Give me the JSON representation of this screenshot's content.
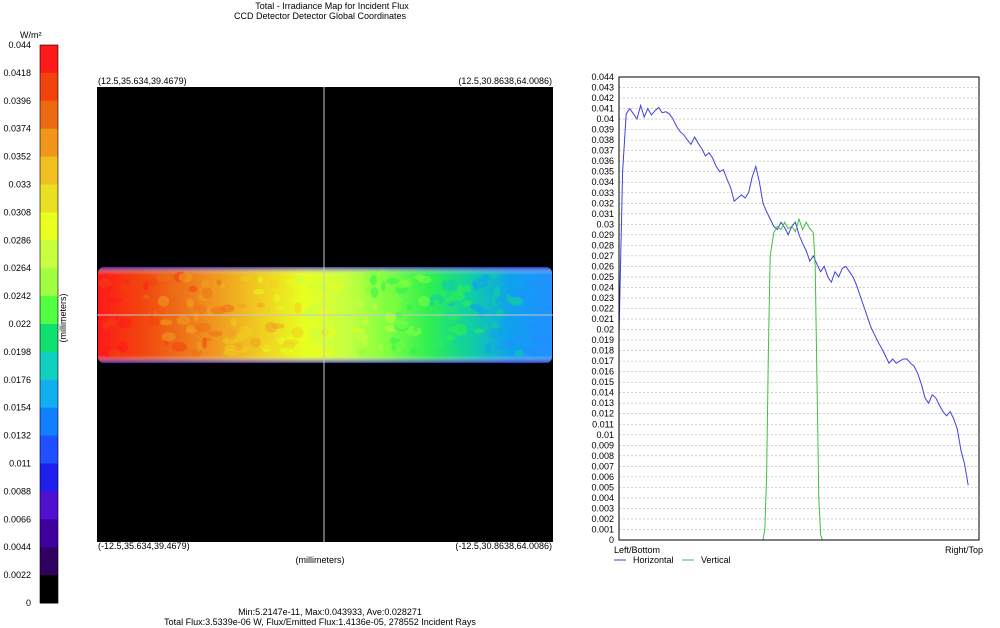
{
  "title_line1": "Total - Irradiance Map for Incident Flux",
  "title_line2": "CCD Detector Detector    Global Coordinates",
  "colorbar": {
    "unit": "W/m²",
    "ticks": [
      "0.044",
      "0.0418",
      "0.0396",
      "0.0374",
      "0.0352",
      "0.033",
      "0.0308",
      "0.0286",
      "0.0264",
      "0.0242",
      "0.022",
      "0.0198",
      "0.0176",
      "0.0154",
      "0.0132",
      "0.011",
      "0.0088",
      "0.0066",
      "0.0044",
      "0.0022",
      "0"
    ],
    "colors": [
      "#ff1a1a",
      "#f2420e",
      "#ee6a10",
      "#f0961a",
      "#f0c020",
      "#e8e020",
      "#e8ff20",
      "#c8ff40",
      "#a0ff40",
      "#50ff40",
      "#10e070",
      "#10d0c0",
      "#10b0f0",
      "#1080ff",
      "#2050ff",
      "#2020ee",
      "#5010d0",
      "#4000a0",
      "#300060",
      "#000000"
    ]
  },
  "map": {
    "ylabel": "(millimeters)",
    "xlabel": "(millimeters)",
    "corner_tl": "(12.5,35.634,39.4679)",
    "corner_tr": "(12.5,30.8638,64.0086)",
    "corner_bl": "(-12.5,35.634,39.4679)",
    "corner_br": "(-12.5,30.8638,64.0086)",
    "background": "#000000",
    "gradient": [
      "#ff1a1a",
      "#f2420e",
      "#ee7018",
      "#f0a020",
      "#f0d020",
      "#e8ff20",
      "#c8ff40",
      "#80ff40",
      "#30f050",
      "#10d0a0",
      "#10a0f0",
      "#2090ff"
    ]
  },
  "stats_line1": "Min:5.2147e-11, Max:0.043933, Ave:0.028271",
  "stats_line2": "Total Flux:3.5339e-06 W, Flux/Emitted Flux:1.4136e-05, 278552 Incident Rays",
  "chart_data": {
    "type": "line",
    "ylim": [
      0,
      0.044
    ],
    "y_ticks": [
      "0.044",
      "0.043",
      "0.042",
      "0.041",
      "0.04",
      "0.039",
      "0.038",
      "0.037",
      "0.036",
      "0.035",
      "0.034",
      "0.033",
      "0.032",
      "0.031",
      "0.03",
      "0.029",
      "0.028",
      "0.027",
      "0.026",
      "0.025",
      "0.024",
      "0.023",
      "0.022",
      "0.021",
      "0.02",
      "0.019",
      "0.018",
      "0.017",
      "0.016",
      "0.015",
      "0.014",
      "0.013",
      "0.012",
      "0.011",
      "0.01",
      "0.009",
      "0.008",
      "0.007",
      "0.006",
      "0.005",
      "0.004",
      "0.003",
      "0.002",
      "0.001",
      "0"
    ],
    "xlim": [
      0,
      1
    ],
    "x_left_label": "Left/Bottom",
    "x_right_label": "Right/Top",
    "grid": true,
    "legend_position": "bottom-left",
    "series": [
      {
        "name": "Horizontal",
        "color": "#4040e0",
        "points": [
          [
            0.0,
            0.0195
          ],
          [
            0.01,
            0.035
          ],
          [
            0.02,
            0.0405
          ],
          [
            0.03,
            0.041
          ],
          [
            0.04,
            0.0405
          ],
          [
            0.05,
            0.04
          ],
          [
            0.06,
            0.0413
          ],
          [
            0.07,
            0.0402
          ],
          [
            0.08,
            0.041
          ],
          [
            0.09,
            0.0404
          ],
          [
            0.1,
            0.0408
          ],
          [
            0.11,
            0.0411
          ],
          [
            0.12,
            0.0406
          ],
          [
            0.13,
            0.0407
          ],
          [
            0.14,
            0.0405
          ],
          [
            0.15,
            0.04
          ],
          [
            0.16,
            0.0393
          ],
          [
            0.17,
            0.0388
          ],
          [
            0.18,
            0.0385
          ],
          [
            0.19,
            0.038
          ],
          [
            0.2,
            0.0376
          ],
          [
            0.21,
            0.0383
          ],
          [
            0.22,
            0.0377
          ],
          [
            0.23,
            0.0372
          ],
          [
            0.24,
            0.0365
          ],
          [
            0.25,
            0.0368
          ],
          [
            0.26,
            0.0363
          ],
          [
            0.27,
            0.0355
          ],
          [
            0.28,
            0.035
          ],
          [
            0.29,
            0.0352
          ],
          [
            0.3,
            0.0343
          ],
          [
            0.31,
            0.0335
          ],
          [
            0.32,
            0.0322
          ],
          [
            0.33,
            0.0325
          ],
          [
            0.34,
            0.0328
          ],
          [
            0.35,
            0.0325
          ],
          [
            0.36,
            0.033
          ],
          [
            0.37,
            0.0345
          ],
          [
            0.38,
            0.0355
          ],
          [
            0.39,
            0.034
          ],
          [
            0.4,
            0.032
          ],
          [
            0.41,
            0.0312
          ],
          [
            0.42,
            0.0305
          ],
          [
            0.43,
            0.0298
          ],
          [
            0.44,
            0.0295
          ],
          [
            0.45,
            0.0302
          ],
          [
            0.46,
            0.0297
          ],
          [
            0.47,
            0.029
          ],
          [
            0.48,
            0.0298
          ],
          [
            0.49,
            0.0302
          ],
          [
            0.5,
            0.029
          ],
          [
            0.51,
            0.0282
          ],
          [
            0.52,
            0.0275
          ],
          [
            0.53,
            0.0265
          ],
          [
            0.54,
            0.027
          ],
          [
            0.55,
            0.0262
          ],
          [
            0.56,
            0.0255
          ],
          [
            0.57,
            0.026
          ],
          [
            0.58,
            0.025
          ],
          [
            0.59,
            0.0245
          ],
          [
            0.6,
            0.0255
          ],
          [
            0.61,
            0.025
          ],
          [
            0.62,
            0.0258
          ],
          [
            0.63,
            0.026
          ],
          [
            0.64,
            0.0255
          ],
          [
            0.65,
            0.025
          ],
          [
            0.66,
            0.0242
          ],
          [
            0.67,
            0.0232
          ],
          [
            0.68,
            0.0222
          ],
          [
            0.69,
            0.0212
          ],
          [
            0.7,
            0.0202
          ],
          [
            0.71,
            0.0195
          ],
          [
            0.72,
            0.0188
          ],
          [
            0.73,
            0.0182
          ],
          [
            0.74,
            0.0175
          ],
          [
            0.75,
            0.0168
          ],
          [
            0.76,
            0.0172
          ],
          [
            0.77,
            0.0168
          ],
          [
            0.78,
            0.017
          ],
          [
            0.79,
            0.0172
          ],
          [
            0.8,
            0.0172
          ],
          [
            0.81,
            0.0168
          ],
          [
            0.82,
            0.0165
          ],
          [
            0.83,
            0.0158
          ],
          [
            0.84,
            0.0148
          ],
          [
            0.85,
            0.0135
          ],
          [
            0.86,
            0.013
          ],
          [
            0.87,
            0.0138
          ],
          [
            0.88,
            0.0135
          ],
          [
            0.89,
            0.0128
          ],
          [
            0.9,
            0.0122
          ],
          [
            0.91,
            0.0118
          ],
          [
            0.92,
            0.0122
          ],
          [
            0.93,
            0.0115
          ],
          [
            0.94,
            0.0105
          ],
          [
            0.95,
            0.0085
          ],
          [
            0.96,
            0.0072
          ],
          [
            0.97,
            0.0052
          ]
        ]
      },
      {
        "name": "Vertical",
        "color": "#40c040",
        "points": [
          [
            0.0,
            0.0
          ],
          [
            0.4,
            0.0
          ],
          [
            0.405,
            0.001
          ],
          [
            0.41,
            0.006
          ],
          [
            0.415,
            0.018
          ],
          [
            0.42,
            0.027
          ],
          [
            0.43,
            0.0292
          ],
          [
            0.44,
            0.0298
          ],
          [
            0.45,
            0.0295
          ],
          [
            0.46,
            0.0302
          ],
          [
            0.47,
            0.0296
          ],
          [
            0.48,
            0.0298
          ],
          [
            0.49,
            0.0293
          ],
          [
            0.5,
            0.0305
          ],
          [
            0.51,
            0.0295
          ],
          [
            0.52,
            0.0302
          ],
          [
            0.53,
            0.0296
          ],
          [
            0.54,
            0.0292
          ],
          [
            0.545,
            0.026
          ],
          [
            0.55,
            0.015
          ],
          [
            0.555,
            0.004
          ],
          [
            0.56,
            0.0005
          ],
          [
            0.565,
            0.0
          ],
          [
            1.0,
            0.0
          ]
        ]
      }
    ]
  }
}
